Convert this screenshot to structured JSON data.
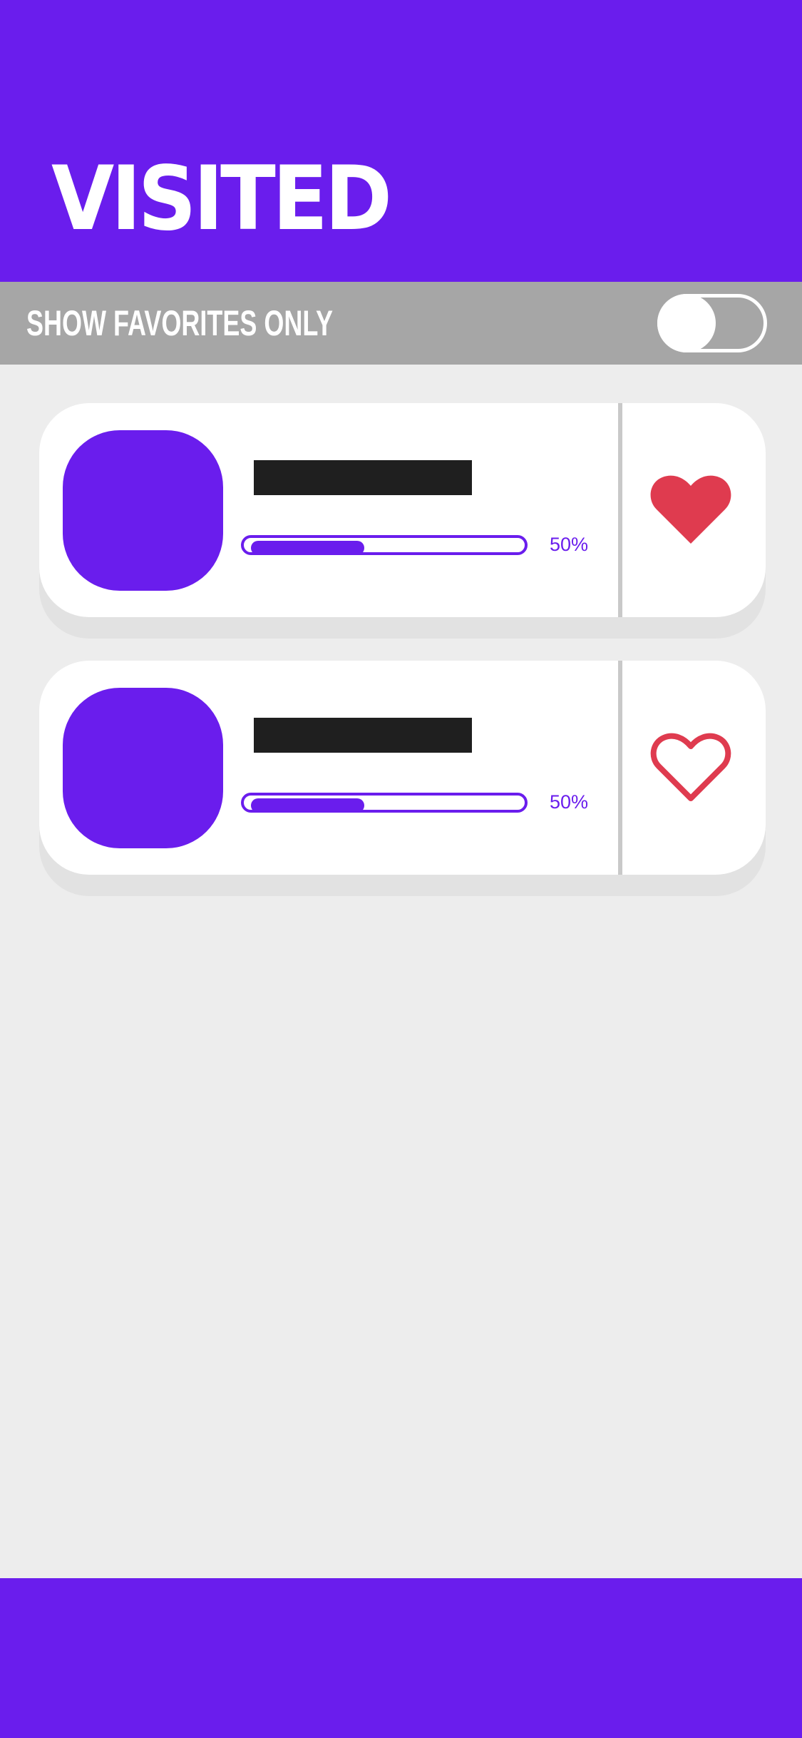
{
  "header": {
    "title": "VISITED"
  },
  "filter": {
    "label": "SHOW FAVORITES ONLY",
    "enabled": false
  },
  "cards": [
    {
      "progress": 0.5,
      "progress_label": "50%",
      "favorite": true,
      "favorite_icon": "heart-filled-icon"
    },
    {
      "progress": 0.5,
      "progress_label": "50%",
      "favorite": false,
      "favorite_icon": "heart-outline-icon"
    }
  ],
  "colors": {
    "primary": "#6a1ded",
    "favorite": "#df3b4f",
    "background": "#ededed",
    "filter_bar": "#a6a6a6"
  }
}
